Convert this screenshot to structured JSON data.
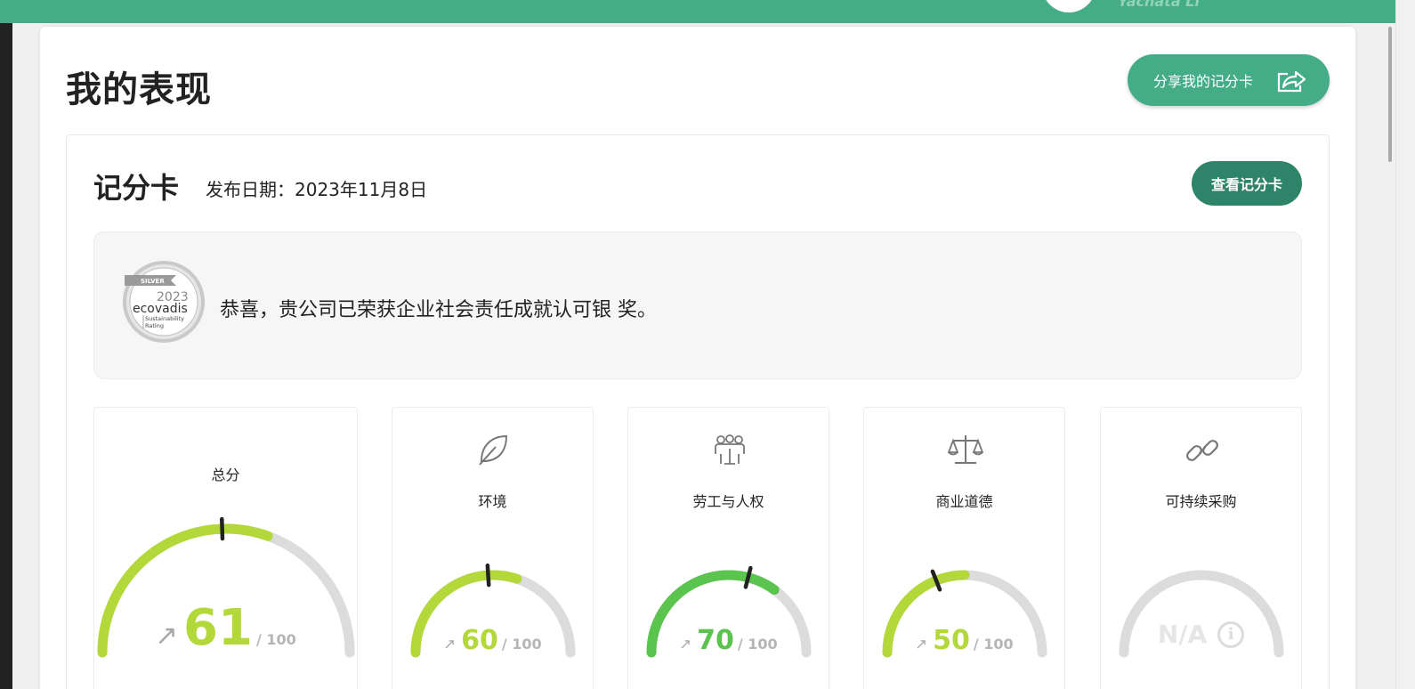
{
  "header": {
    "user_name": "Yachata Li"
  },
  "page": {
    "title": "我的表现",
    "share_label": "分享我的记分卡"
  },
  "scorecard": {
    "title": "记分卡",
    "published": "发布日期：2023年11月8日",
    "view_label": "查看记分卡",
    "banner_text": "恭喜，贵公司已荣获企业社会责任成就认可银 奖。",
    "medal": {
      "tier": "SILVER",
      "year": "2023",
      "brand": "ecovadis",
      "subtitle1": "Sustainability",
      "subtitle2": "Rating"
    }
  },
  "gauges": [
    {
      "label": "总分",
      "value": 61,
      "display": "61",
      "max_label": "/ 100",
      "trend": "↗",
      "color": "#b2d83a",
      "icon": ""
    },
    {
      "label": "环境",
      "value": 60,
      "display": "60",
      "max_label": "/ 100",
      "trend": "↗",
      "color": "#b2d83a",
      "icon": "leaf-icon"
    },
    {
      "label": "劳工与人权",
      "value": 70,
      "display": "70",
      "max_label": "/ 100",
      "trend": "↗",
      "color": "#5ac44f",
      "icon": "people-icon"
    },
    {
      "label": "商业道德",
      "value": 50,
      "display": "50",
      "max_label": "/ 100",
      "trend": "↗",
      "color": "#b2d83a",
      "icon": "scales-icon"
    },
    {
      "label": "可持续采购",
      "value": null,
      "display": "N/A",
      "max_label": "",
      "trend": "",
      "color": "#dcdcdc",
      "icon": "link-icon"
    }
  ],
  "colors": {
    "brand": "#44ad88",
    "button_dark": "#2e8468",
    "track": "#dcdcdc"
  }
}
